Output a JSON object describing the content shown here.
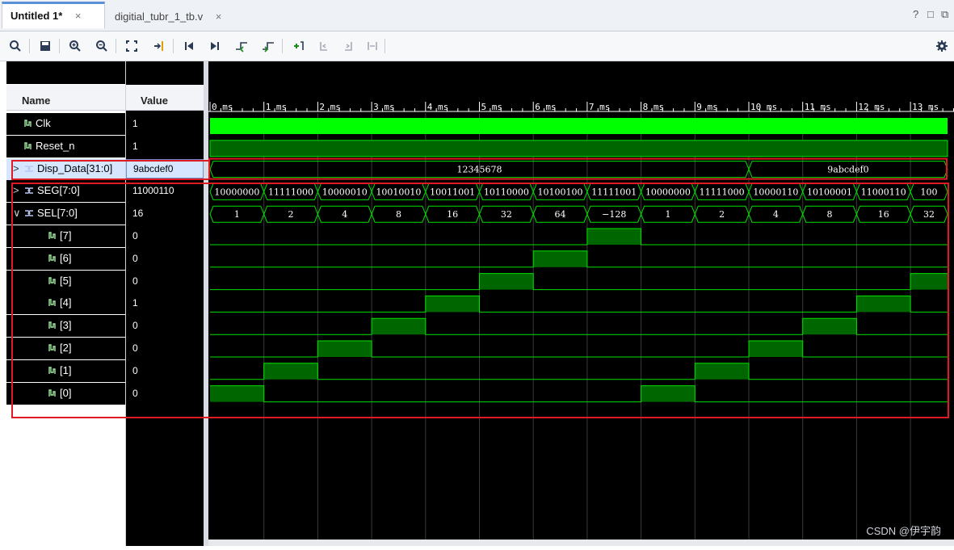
{
  "tabs": [
    {
      "label": "Untitled 1*",
      "active": true
    },
    {
      "label": "digitial_tubr_1_tb.v",
      "active": false
    }
  ],
  "window_controls": [
    "?",
    "□",
    "⧉"
  ],
  "toolbar": {
    "icons": [
      "search-icon",
      "save-icon",
      "zoom-in-icon",
      "zoom-out-icon",
      "zoom-fit-icon",
      "go-to-cursor-icon",
      "go-to-start-icon",
      "go-to-end-icon",
      "previous-transition-icon",
      "next-transition-icon",
      "add-marker-icon",
      "previous-marker-icon",
      "next-marker-icon",
      "swap-cursors-icon",
      "settings-gear-icon"
    ]
  },
  "columns": {
    "name": "Name",
    "value": "Value"
  },
  "time_axis": {
    "labels": [
      "0 ms",
      "1 ms",
      "2 ms",
      "3 ms",
      "4 ms",
      "5 ms",
      "6 ms",
      "7 ms",
      "8 ms",
      "9 ms",
      "10 ms",
      "11 ms",
      "12 ms",
      "13 ms"
    ]
  },
  "signals": [
    {
      "name": "Clk",
      "value": "1",
      "kind": "wire"
    },
    {
      "name": "Reset_n",
      "value": "1",
      "kind": "wire"
    },
    {
      "name": "Disp_Data[31:0]",
      "value": "9abcdef0",
      "kind": "bus",
      "expander": ">",
      "selected": true
    },
    {
      "name": "SEG[7:0]",
      "value": "11000110",
      "kind": "bus",
      "expander": ">"
    },
    {
      "name": "SEL[7:0]",
      "value": "16",
      "kind": "bus",
      "expander": "∨"
    },
    {
      "name": "[7]",
      "value": "0",
      "kind": "wire",
      "indent": true
    },
    {
      "name": "[6]",
      "value": "0",
      "kind": "wire",
      "indent": true
    },
    {
      "name": "[5]",
      "value": "0",
      "kind": "wire",
      "indent": true
    },
    {
      "name": "[4]",
      "value": "1",
      "kind": "wire",
      "indent": true
    },
    {
      "name": "[3]",
      "value": "0",
      "kind": "wire",
      "indent": true
    },
    {
      "name": "[2]",
      "value": "0",
      "kind": "wire",
      "indent": true
    },
    {
      "name": "[1]",
      "value": "0",
      "kind": "wire",
      "indent": true
    },
    {
      "name": "[0]",
      "value": "0",
      "kind": "wire",
      "indent": true
    }
  ],
  "waves": {
    "disp_data_segments": [
      "12345678",
      "9abcdef0"
    ],
    "disp_data_change_ms": 10.0,
    "seg_values": [
      "10000000",
      "11111000",
      "10000010",
      "10010010",
      "10011001",
      "10110000",
      "10100100",
      "11111001",
      "10000000",
      "11111000",
      "10000110",
      "10100001",
      "11000110",
      "100"
    ],
    "sel_values": [
      "1",
      "2",
      "4",
      "8",
      "16",
      "32",
      "64",
      "−128",
      "1",
      "2",
      "4",
      "8",
      "16",
      "32"
    ],
    "sel_bit_high_order": [
      0,
      1,
      2,
      3,
      4,
      5,
      6,
      7,
      0,
      1,
      2,
      3,
      4,
      5
    ]
  },
  "colors": {
    "wave_green": "#00e000",
    "wave_fill": "#006600",
    "highlight_box": "#e01a22",
    "grid": "#2a2a2a",
    "clk_bright": "#00ff00"
  },
  "watermark": "CSDN @伊宇韵"
}
